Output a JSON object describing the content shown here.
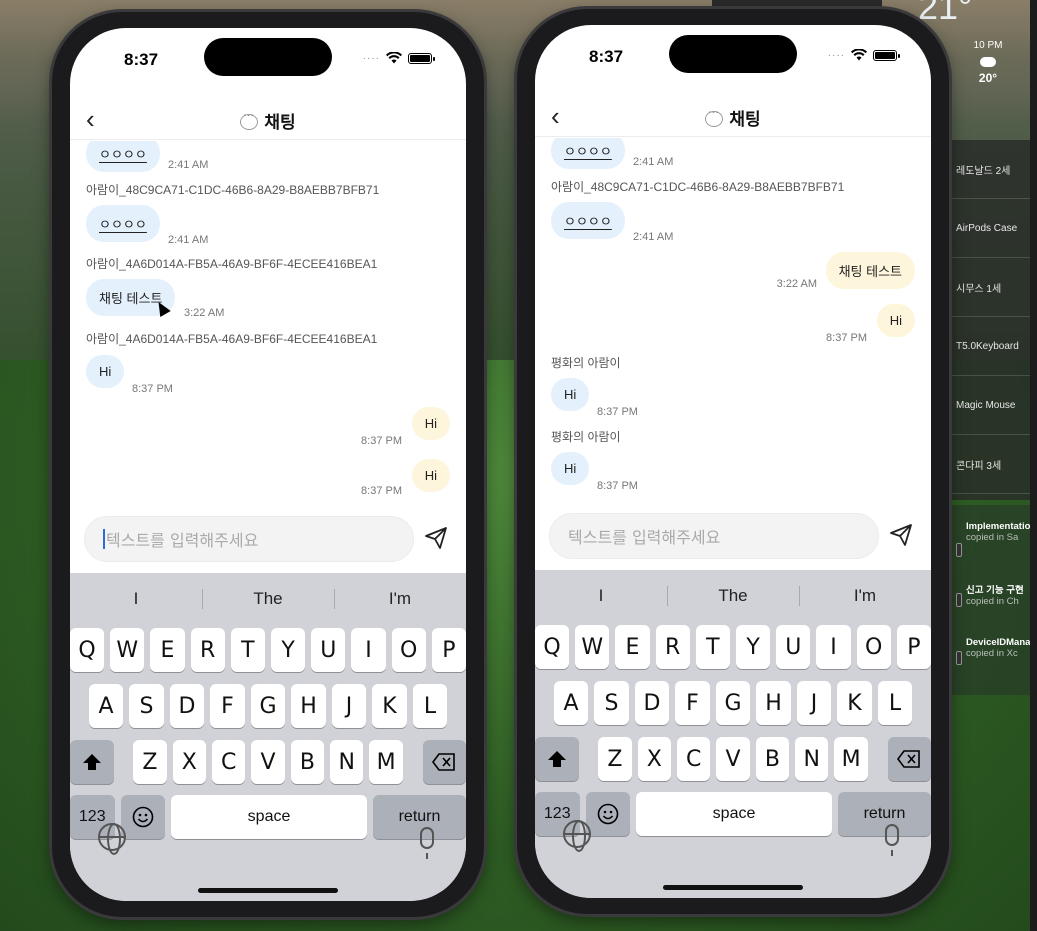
{
  "desktop": {
    "temperature": "21°",
    "weather": {
      "time": "10 PM",
      "temp": "20°"
    },
    "list_items": [
      "레도날드 2세",
      "AirPods Case",
      "시무스 1세",
      "T5.0Keyboard",
      "Magic Mouse",
      "콘다피 3세"
    ],
    "clips": [
      {
        "title": "Implementation reporting fu",
        "sub": "copied in Sa"
      },
      {
        "title": "신고 기능 구현",
        "sub": "copied in Ch"
      },
      {
        "title": "DeviceIDManager.getID",
        "sub": "copied in Xc"
      }
    ]
  },
  "phone_left": {
    "status_time": "8:37",
    "title": "채팅",
    "messages": [
      {
        "kind": "in",
        "text": "ㅇㅇㅇㅇ",
        "time": "2:41 AM"
      },
      {
        "kind": "sender",
        "text": "아람이_48C9CA71-C1DC-46B6-8A29-B8AEBB7BFB71"
      },
      {
        "kind": "in",
        "text": "ㅇㅇㅇㅇ",
        "time": "2:41 AM"
      },
      {
        "kind": "sender",
        "text": "아람이_4A6D014A-FB5A-46A9-BF6F-4ECEE416BEA1"
      },
      {
        "kind": "in",
        "text": "채팅 테스트",
        "time": "3:22 AM"
      },
      {
        "kind": "sender",
        "text": "아람이_4A6D014A-FB5A-46A9-BF6F-4ECEE416BEA1"
      },
      {
        "kind": "in",
        "text": "Hi",
        "time": "8:37 PM"
      },
      {
        "kind": "out",
        "text": "Hi",
        "time": "8:37 PM"
      },
      {
        "kind": "out",
        "text": "Hi",
        "time": "8:37 PM"
      }
    ],
    "input_placeholder": "텍스트를 입력해주세요"
  },
  "phone_right": {
    "status_time": "8:37",
    "title": "채팅",
    "messages": [
      {
        "kind": "in",
        "text": "ㅇㅇㅇㅇ",
        "time": "2:41 AM"
      },
      {
        "kind": "sender",
        "text": "아람이_48C9CA71-C1DC-46B6-8A29-B8AEBB7BFB71"
      },
      {
        "kind": "in",
        "text": "ㅇㅇㅇㅇ",
        "time": "2:41 AM"
      },
      {
        "kind": "out",
        "text": "채팅 테스트",
        "time": "3:22 AM"
      },
      {
        "kind": "out",
        "text": "Hi",
        "time": "8:37 PM"
      },
      {
        "kind": "sender",
        "text": "평화의 아람이"
      },
      {
        "kind": "in",
        "text": "Hi",
        "time": "8:37 PM"
      },
      {
        "kind": "sender",
        "text": "평화의 아람이"
      },
      {
        "kind": "in",
        "text": "Hi",
        "time": "8:37 PM"
      }
    ],
    "input_placeholder": "텍스트를 입력해주세요"
  },
  "keyboard": {
    "suggestions": [
      "I",
      "The",
      "I'm"
    ],
    "row1": [
      "Q",
      "W",
      "E",
      "R",
      "T",
      "Y",
      "U",
      "I",
      "O",
      "P"
    ],
    "row2": [
      "A",
      "S",
      "D",
      "F",
      "G",
      "H",
      "J",
      "K",
      "L"
    ],
    "row3": [
      "Z",
      "X",
      "C",
      "V",
      "B",
      "N",
      "M"
    ],
    "numbers_label": "123",
    "space_label": "space",
    "return_label": "return"
  }
}
